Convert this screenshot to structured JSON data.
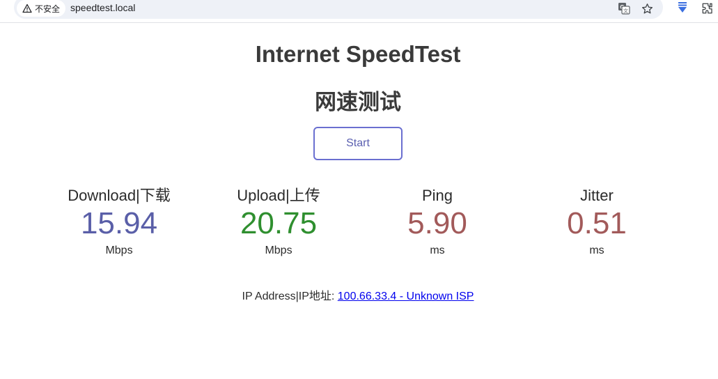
{
  "browser": {
    "security_label": "不安全",
    "url": "speedtest.local",
    "icons": [
      "warning-icon",
      "translate-icon",
      "star-icon",
      "download-arrow-icon",
      "extensions-icon"
    ]
  },
  "page": {
    "title_en": "Internet SpeedTest",
    "title_cn": "网速测试",
    "start_label": "Start",
    "metrics": [
      {
        "label": "Download|下载",
        "value": "15.94",
        "unit": "Mbps",
        "color": "#5a5fa8"
      },
      {
        "label": "Upload|上传",
        "value": "20.75",
        "unit": "Mbps",
        "color": "#2f8f2f"
      },
      {
        "label": "Ping",
        "value": "5.90",
        "unit": "ms",
        "color": "#a25a5a"
      },
      {
        "label": "Jitter",
        "value": "0.51",
        "unit": "ms",
        "color": "#a25a5a"
      }
    ],
    "ip_prefix": "IP Address|IP地址: ",
    "ip_link": "100.66.33.4 - Unknown ISP"
  }
}
